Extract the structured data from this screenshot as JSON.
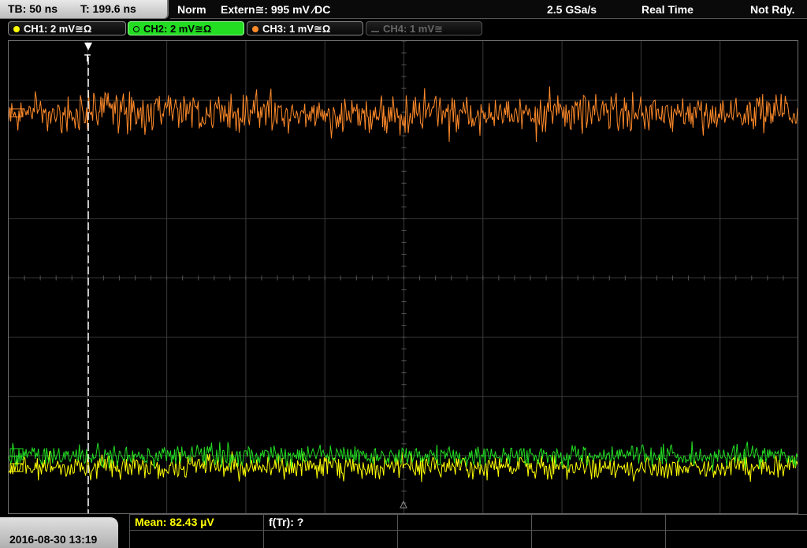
{
  "header": {
    "timebase": "TB: 50 ns",
    "trigger_time": "T: 199.6 ns",
    "trigger_mode": "Norm",
    "trigger_source": "Extern≅: 995 mV ⁄DC",
    "sample_rate": "2.5 GSa/s",
    "acq_mode": "Real Time",
    "status": "Not Rdy."
  },
  "channels": [
    {
      "label": "CH1: 2 mV≅Ω",
      "color": "#ffff00",
      "state": "on"
    },
    {
      "label": "CH2: 2 mV≅Ω",
      "color": "#00ff00",
      "state": "active"
    },
    {
      "label": "CH3: 1 mV≅Ω",
      "color": "#ff8a2a",
      "state": "on"
    },
    {
      "label": "CH4: 1 mV≅",
      "color": "#555555",
      "state": "off"
    }
  ],
  "trigger_marker": "T",
  "footer": {
    "datetime": "2016-08-30 13:19",
    "measure_1": "Mean: 82.43 µV",
    "measure_2": "f(Tr): ?"
  },
  "colors": {
    "ch1": "#ffff00",
    "ch2": "#22dd22",
    "ch3": "#ff8a2a",
    "grid": "#3a3a3a",
    "trigger": "#ffffff"
  }
}
